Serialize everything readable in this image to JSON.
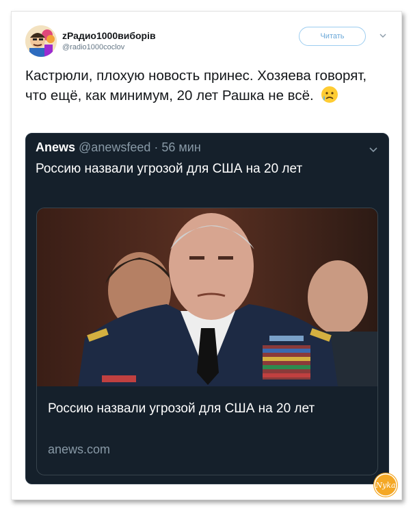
{
  "header": {
    "display_name": "zРадио1000виборів",
    "handle": "@radio1000coclov",
    "follow_label": "Читать"
  },
  "tweet": {
    "text": "Кастрюли, плохую новость принес. Хозяева говорят, что ещё, как минимум, 20 лет Рашка не всё.",
    "emoji": "sad-tear-emoji"
  },
  "quoted": {
    "source_name": "Anews",
    "source_rest": " @anewsfeed · 56 мин",
    "text": "Россию назвали угрозой для США на 20 лет",
    "link_card": {
      "title": "Россию назвали угрозой для США на 20 лет",
      "domain": "anews.com"
    }
  },
  "watermark_text": "Nyka",
  "colors": {
    "card_bg": "#15202b",
    "card_border": "#38444d",
    "muted": "#8899a6",
    "follow_border": "#9ccdf0"
  }
}
